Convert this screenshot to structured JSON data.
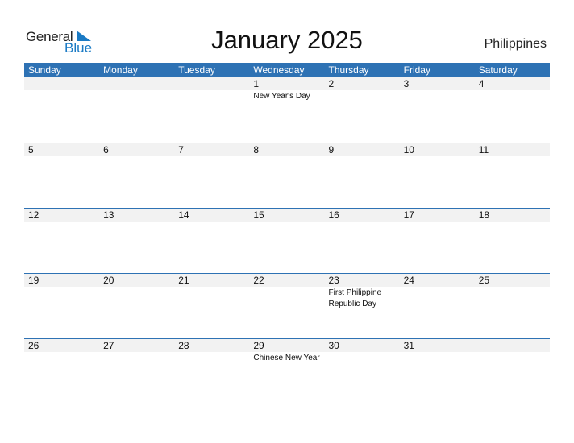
{
  "logo": {
    "word1": "General",
    "word2": "Blue",
    "icon": "triangle-flag-icon"
  },
  "title": "January 2025",
  "country": "Philippines",
  "colors": {
    "accent": "#2e72b4",
    "day_strip": "#f2f2f2",
    "logo_blue": "#1a7ac4"
  },
  "weekdays": [
    "Sunday",
    "Monday",
    "Tuesday",
    "Wednesday",
    "Thursday",
    "Friday",
    "Saturday"
  ],
  "weeks": [
    [
      {
        "num": "",
        "event": ""
      },
      {
        "num": "",
        "event": ""
      },
      {
        "num": "",
        "event": ""
      },
      {
        "num": "1",
        "event": "New Year's Day"
      },
      {
        "num": "2",
        "event": ""
      },
      {
        "num": "3",
        "event": ""
      },
      {
        "num": "4",
        "event": ""
      }
    ],
    [
      {
        "num": "5",
        "event": ""
      },
      {
        "num": "6",
        "event": ""
      },
      {
        "num": "7",
        "event": ""
      },
      {
        "num": "8",
        "event": ""
      },
      {
        "num": "9",
        "event": ""
      },
      {
        "num": "10",
        "event": ""
      },
      {
        "num": "11",
        "event": ""
      }
    ],
    [
      {
        "num": "12",
        "event": ""
      },
      {
        "num": "13",
        "event": ""
      },
      {
        "num": "14",
        "event": ""
      },
      {
        "num": "15",
        "event": ""
      },
      {
        "num": "16",
        "event": ""
      },
      {
        "num": "17",
        "event": ""
      },
      {
        "num": "18",
        "event": ""
      }
    ],
    [
      {
        "num": "19",
        "event": ""
      },
      {
        "num": "20",
        "event": ""
      },
      {
        "num": "21",
        "event": ""
      },
      {
        "num": "22",
        "event": ""
      },
      {
        "num": "23",
        "event": "First Philippine Republic Day"
      },
      {
        "num": "24",
        "event": ""
      },
      {
        "num": "25",
        "event": ""
      }
    ],
    [
      {
        "num": "26",
        "event": ""
      },
      {
        "num": "27",
        "event": ""
      },
      {
        "num": "28",
        "event": ""
      },
      {
        "num": "29",
        "event": "Chinese New Year"
      },
      {
        "num": "30",
        "event": ""
      },
      {
        "num": "31",
        "event": ""
      },
      {
        "num": "",
        "event": ""
      }
    ]
  ]
}
